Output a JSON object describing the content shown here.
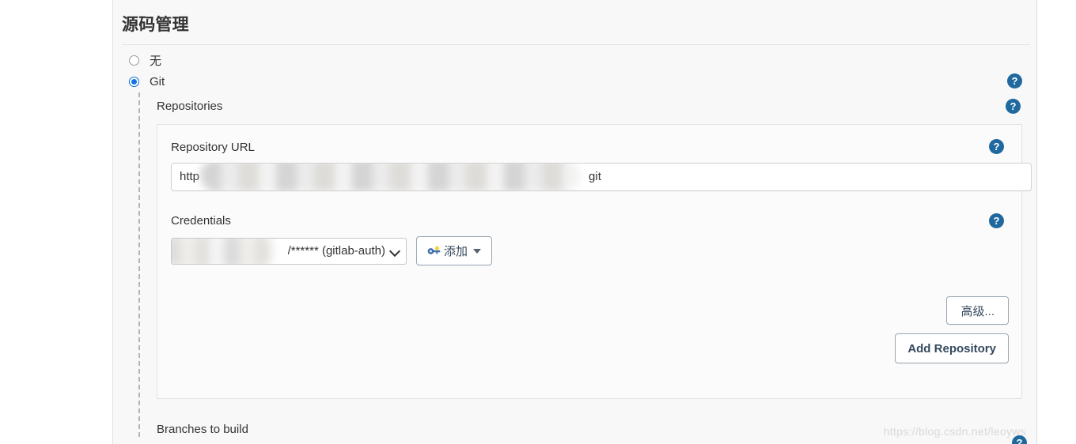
{
  "page": {
    "section_title": "源码管理",
    "watermark": "https://blog.csdn.net/leoyws"
  },
  "scm": {
    "options": [
      {
        "label": "无",
        "selected": false
      },
      {
        "label": "Git",
        "selected": true
      }
    ],
    "repositories_label": "Repositories",
    "repository": {
      "url_label": "Repository URL",
      "url_prefix": "http",
      "url_suffix": "git",
      "url_redacted": true,
      "credentials_label": "Credentials",
      "credentials_value": "/****** (gitlab-auth)",
      "credentials_redacted": true,
      "add_credentials_label": "添加",
      "advanced_label": "高级...",
      "add_repository_label": "Add Repository"
    },
    "branches_label": "Branches to build"
  },
  "icons": {
    "help": "?",
    "help_color": "#20699e",
    "key_body_color": "#3f6faa",
    "key_tip_color": "#f2d43c"
  }
}
